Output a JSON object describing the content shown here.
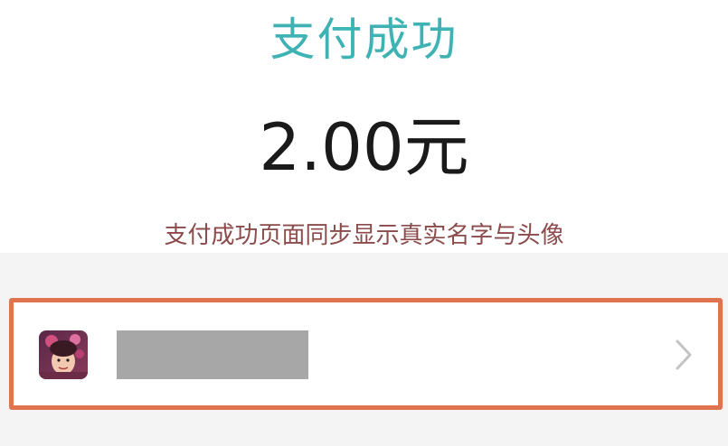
{
  "payment": {
    "status_title": "支付成功",
    "amount": "2.00元",
    "note": "支付成功页面同步显示真实名字与头像"
  },
  "payee": {
    "name_redacted": true
  },
  "colors": {
    "title": "#3fb2b4",
    "amount": "#1a1a1a",
    "note": "#8b4b4b",
    "highlight_border": "#e0744f",
    "redaction": "#a7a7a7"
  },
  "icons": {
    "avatar": "user-avatar",
    "chevron": "chevron-right-icon"
  }
}
